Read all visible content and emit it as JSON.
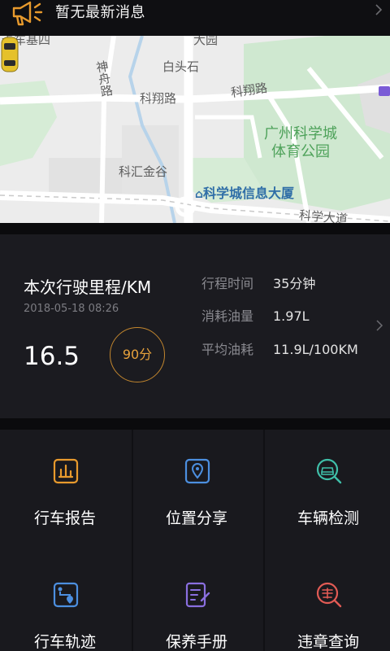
{
  "notice": {
    "text": "暂无最新消息",
    "icon": "megaphone-icon",
    "accent": "#e89a2d"
  },
  "map": {
    "labels": {
      "baitoushi": "白头石",
      "kexiang_left": "科翔路",
      "kexiang_right": "科翔路",
      "shenzhou": "神舟路",
      "park": "广州科学城\n体育公园",
      "kehui": "科汇金谷",
      "poi": "科学城信息大厦",
      "kexue_road": "科学大道",
      "top_left": "卡车基四",
      "top_mid": "大园"
    }
  },
  "trip": {
    "title": "本次行驶里程/KM",
    "date": "2018-05-18 08:26",
    "distance": "16.5",
    "score": "90分",
    "stats": [
      {
        "key": "行程时间",
        "value": "35分钟"
      },
      {
        "key": "消耗油量",
        "value": "1.97L"
      },
      {
        "key": "平均油耗",
        "value": "11.9L/100KM"
      }
    ],
    "score_color": "#e7a23c"
  },
  "menu": [
    {
      "label": "行车报告",
      "icon": "chart-report-icon",
      "color": "#e89a2d"
    },
    {
      "label": "位置分享",
      "icon": "location-pin-icon",
      "color": "#4c8fe0"
    },
    {
      "label": "车辆检测",
      "icon": "car-inspect-icon",
      "color": "#3fbfa9"
    },
    {
      "label": "行车轨迹",
      "icon": "route-track-icon",
      "color": "#4c8fe0"
    },
    {
      "label": "保养手册",
      "icon": "maintenance-book-icon",
      "color": "#8a6fe0"
    },
    {
      "label": "违章查询",
      "icon": "violation-search-icon",
      "color": "#e25b55"
    }
  ]
}
